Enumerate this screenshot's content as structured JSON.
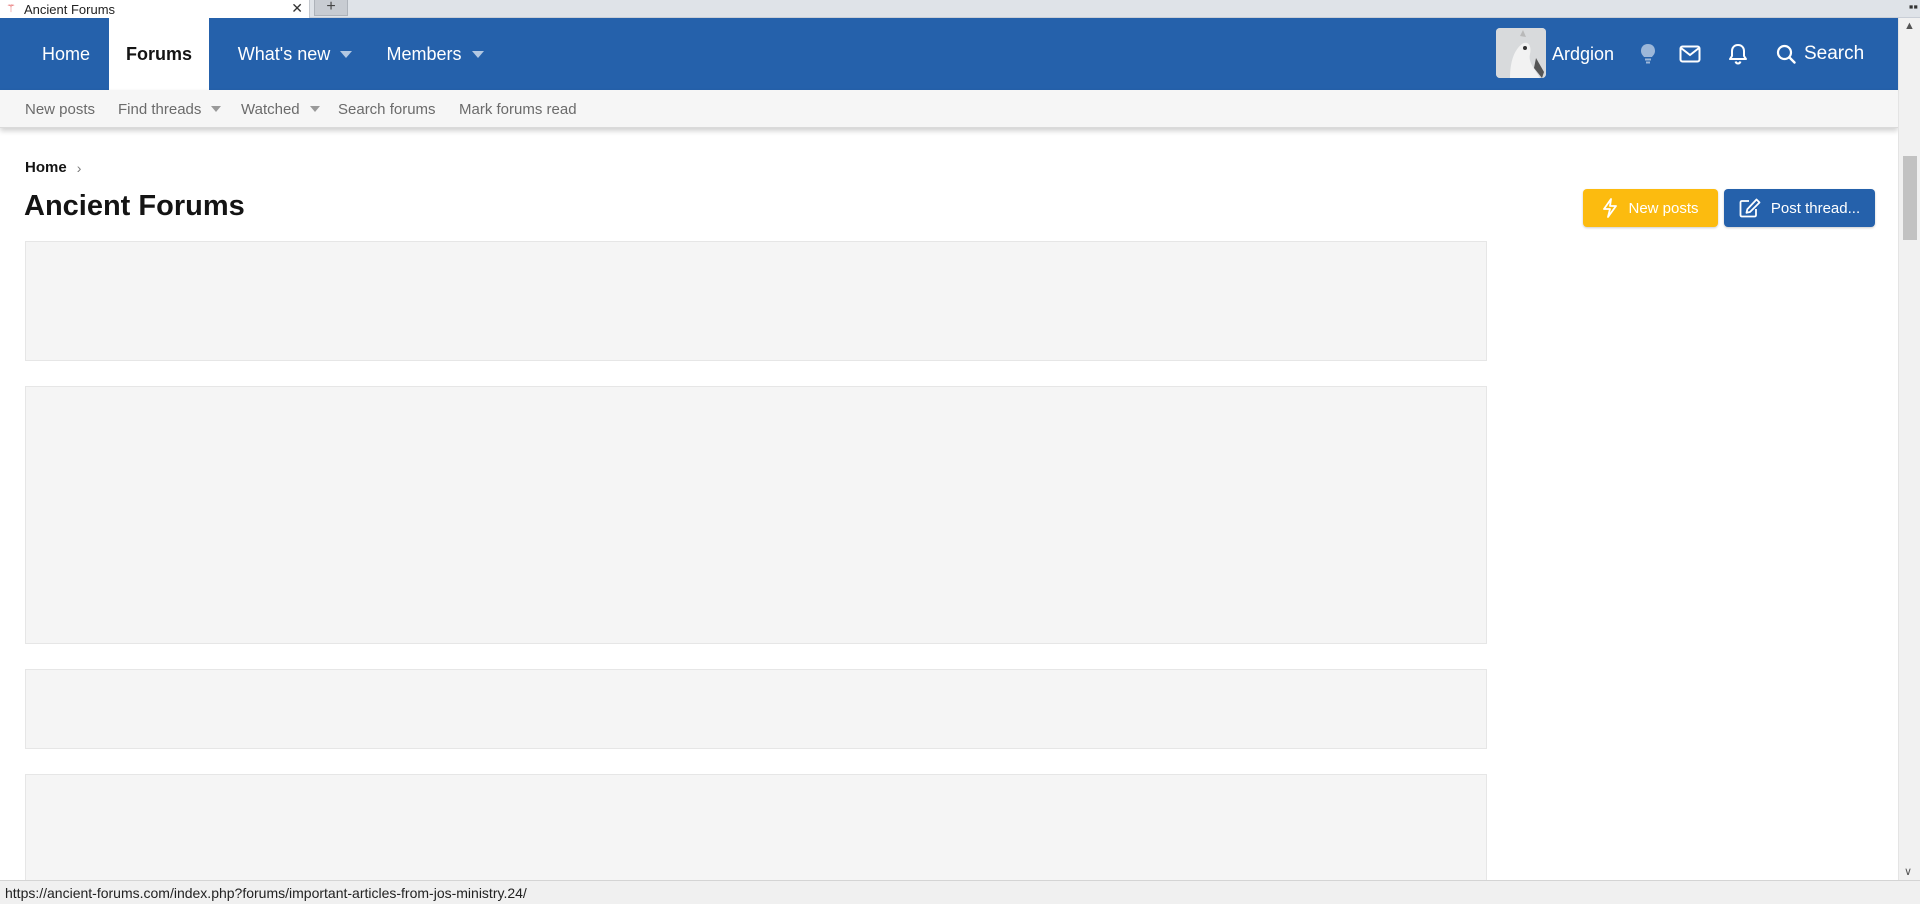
{
  "browser": {
    "tab_title": "Ancient Forums",
    "tab_close": "✕",
    "new_tab": "+",
    "status_url": "https://ancient-forums.com/index.php?forums/important-articles-from-jos-ministry.24/"
  },
  "header": {
    "nav": [
      {
        "label": "Home"
      },
      {
        "label": "Forums",
        "active": true
      },
      {
        "label": "What's new",
        "has_menu": true
      },
      {
        "label": "Members",
        "has_menu": true
      }
    ],
    "username": "Ardgion",
    "search_label": "Search",
    "colors": {
      "bar": "#2561ab",
      "active_tab": "#ffffff"
    }
  },
  "subnav": {
    "items": [
      {
        "label": "New posts"
      },
      {
        "label": "Find threads",
        "has_menu": true
      },
      {
        "label": "Watched",
        "has_menu": true
      },
      {
        "label": "Search forums"
      },
      {
        "label": "Mark forums read"
      }
    ]
  },
  "breadcrumb": {
    "home": "Home",
    "separator": "›"
  },
  "page": {
    "title": "Ancient Forums",
    "new_posts_button": "New posts",
    "post_thread_button": "Post thread...",
    "colors": {
      "new_posts": "#fcbb0f",
      "post_thread": "#2561ab"
    }
  }
}
